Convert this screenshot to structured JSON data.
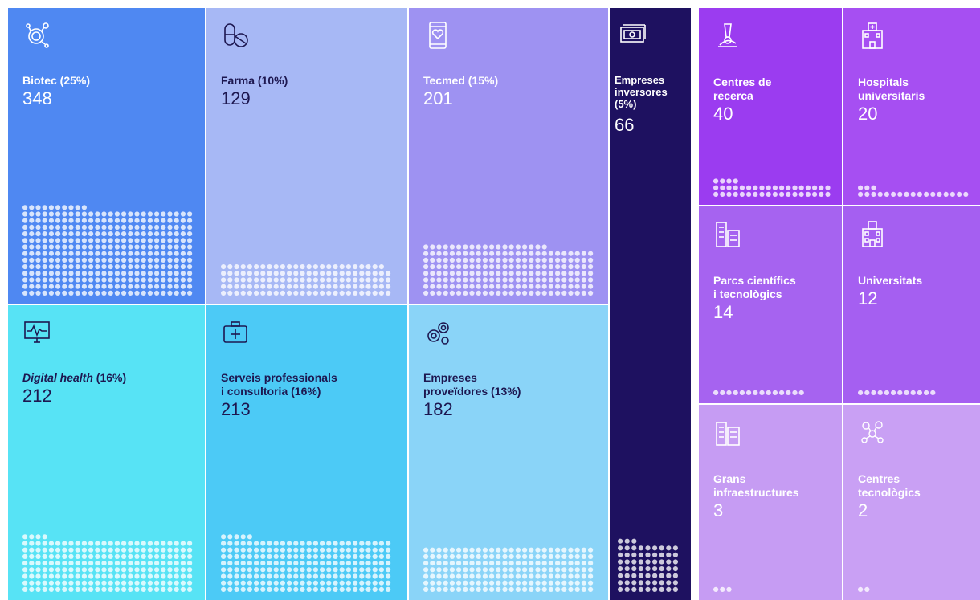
{
  "chart_data": {
    "type": "treemap",
    "title": "",
    "colors": {
      "biotec": "#4f88f2",
      "farma": "#a7b8f5",
      "tecmed": "#9e92f2",
      "inversores": "#1e1160",
      "centres_recerca": "#9b3cf0",
      "hospitals": "#a64ff2",
      "parcs": "#a663f0",
      "universitats": "#a55ff1",
      "infra": "#c69cf3",
      "centres_tecno": "#c9a0f4",
      "digital": "#57e3f5",
      "serveis": "#4ccaf6",
      "proveidores": "#8ad4f8"
    },
    "items": [
      {
        "key": "biotec",
        "label": "Biotec (25%)",
        "value": 348,
        "icon": "molecule-icon",
        "text_color": "#ffffff"
      },
      {
        "key": "farma",
        "label": "Farma (10%)",
        "value": 129,
        "icon": "pill-icon",
        "text_color": "#1d1750"
      },
      {
        "key": "tecmed",
        "label": "Tecmed (15%)",
        "value": 201,
        "icon": "phone-heart-icon",
        "text_color": "#ffffff"
      },
      {
        "key": "inversores",
        "label_lines": [
          "Empreses",
          "inversores",
          "(5%)"
        ],
        "value": 66,
        "icon": "banknote-icon",
        "text_color": "#ffffff"
      },
      {
        "key": "centres_recerca",
        "label_lines": [
          "Centres de",
          "recerca"
        ],
        "value": 40,
        "icon": "microscope-icon",
        "text_color": "#ffffff"
      },
      {
        "key": "hospitals",
        "label_lines": [
          "Hospitals",
          "universitaris"
        ],
        "value": 20,
        "icon": "hospital-icon",
        "text_color": "#ffffff"
      },
      {
        "key": "parcs",
        "label_lines": [
          "Parcs científics",
          "i tecnològics"
        ],
        "value": 14,
        "icon": "buildings-icon",
        "text_color": "#ffffff"
      },
      {
        "key": "universitats",
        "label_lines": [
          "Universitats"
        ],
        "value": 12,
        "icon": "university-icon",
        "text_color": "#ffffff"
      },
      {
        "key": "infra",
        "label_lines": [
          "Grans",
          "infraestructures"
        ],
        "value": 3,
        "icon": "facility-icon",
        "text_color": "#ffffff"
      },
      {
        "key": "centres_tecno",
        "label_lines": [
          "Centres",
          "tecnològics"
        ],
        "value": 2,
        "icon": "network-icon",
        "text_color": "#ffffff"
      },
      {
        "key": "digital",
        "label_italic": "Digital health",
        "label_rest": " (16%)",
        "value": 212,
        "icon": "monitor-pulse-icon",
        "text_color": "#1d1750"
      },
      {
        "key": "serveis",
        "label_lines": [
          "Serveis professionals",
          "i consultoria (16%)"
        ],
        "value": 213,
        "icon": "medkit-icon",
        "text_color": "#1d1750"
      },
      {
        "key": "proveidores",
        "label_lines": [
          "Empreses",
          "proveïdores (13%)"
        ],
        "value": 182,
        "icon": "gears-icon",
        "text_color": "#1d1750"
      }
    ]
  }
}
